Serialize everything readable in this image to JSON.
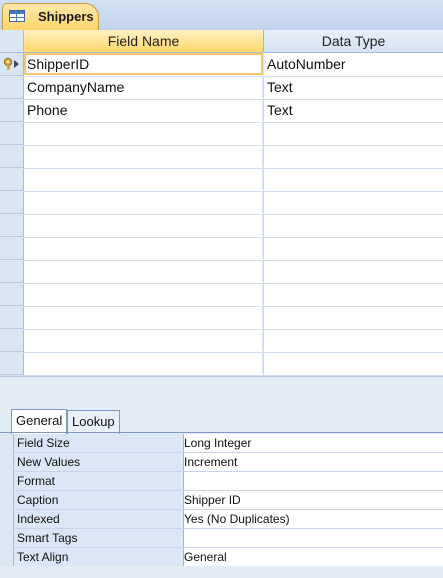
{
  "tab": {
    "title": "Shippers",
    "icon": "table-icon"
  },
  "grid": {
    "columns": [
      "Field Name",
      "Data Type"
    ],
    "rows": [
      {
        "field": "ShipperID",
        "type": "AutoNumber",
        "primary_key": true
      },
      {
        "field": "CompanyName",
        "type": "Text"
      },
      {
        "field": "Phone",
        "type": "Text"
      }
    ]
  },
  "property_tabs": [
    "General",
    "Lookup"
  ],
  "properties": [
    {
      "label": "Field Size",
      "value": "Long Integer"
    },
    {
      "label": "New Values",
      "value": "Increment"
    },
    {
      "label": "Format",
      "value": ""
    },
    {
      "label": "Caption",
      "value": "Shipper ID"
    },
    {
      "label": "Indexed",
      "value": "Yes (No Duplicates)"
    },
    {
      "label": "Smart Tags",
      "value": ""
    },
    {
      "label": "Text Align",
      "value": "General"
    }
  ],
  "colors": {
    "accent": "#ffd66e",
    "header_bg": "#dbe6f4"
  }
}
